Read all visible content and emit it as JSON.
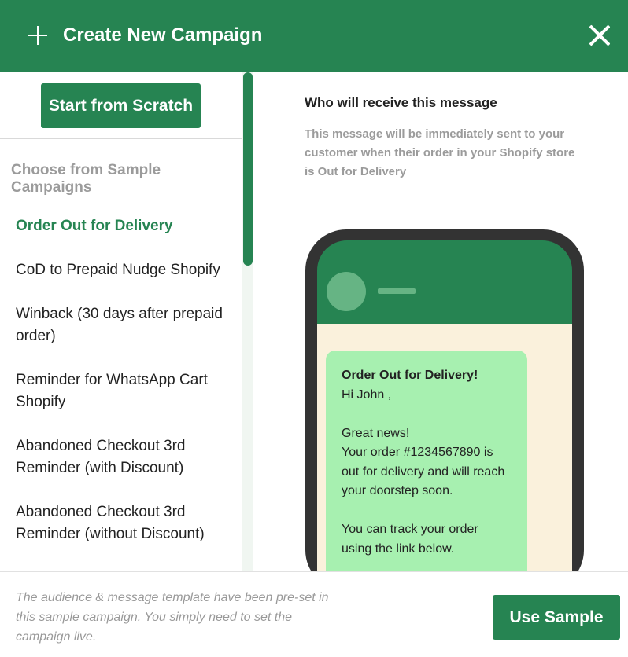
{
  "header": {
    "title": "Create New Campaign",
    "icon_left": "plus-icon",
    "icon_right": "close-icon"
  },
  "sidebar": {
    "scratch_label": "Start from Scratch",
    "choose_label": "Choose from Sample Campaigns",
    "items": [
      {
        "label": "Order Out for Delivery",
        "active": true
      },
      {
        "label": "CoD to Prepaid Nudge Shopify",
        "active": false
      },
      {
        "label": "Winback (30 days after prepaid order)",
        "active": false
      },
      {
        "label": "Reminder for WhatsApp Cart Shopify",
        "active": false
      },
      {
        "label": "Abandoned Checkout 3rd Reminder (with Discount)",
        "active": false
      },
      {
        "label": "Abandoned Checkout 3rd Reminder (without Discount)",
        "active": false
      }
    ]
  },
  "preview": {
    "heading": "Who will receive this message",
    "description": "This message will be immediately sent to your customer when their order in your Shopify store is Out for Delivery",
    "message": {
      "title": "Order Out for Delivery!",
      "greeting": "Hi John ,",
      "line1": "Great news!",
      "line2": "Your order #1234567890 is out for delivery and will reach your doorstep soon.",
      "line3": "You can track your order using the link below."
    }
  },
  "footer": {
    "note": "The audience & message template have been pre-set in this sample campaign. You simply need to set the campaign live.",
    "use_label": "Use Sample"
  },
  "colors": {
    "brand": "#268452",
    "bubble": "#a7f0b0",
    "chat_bg": "#faf1dc"
  }
}
